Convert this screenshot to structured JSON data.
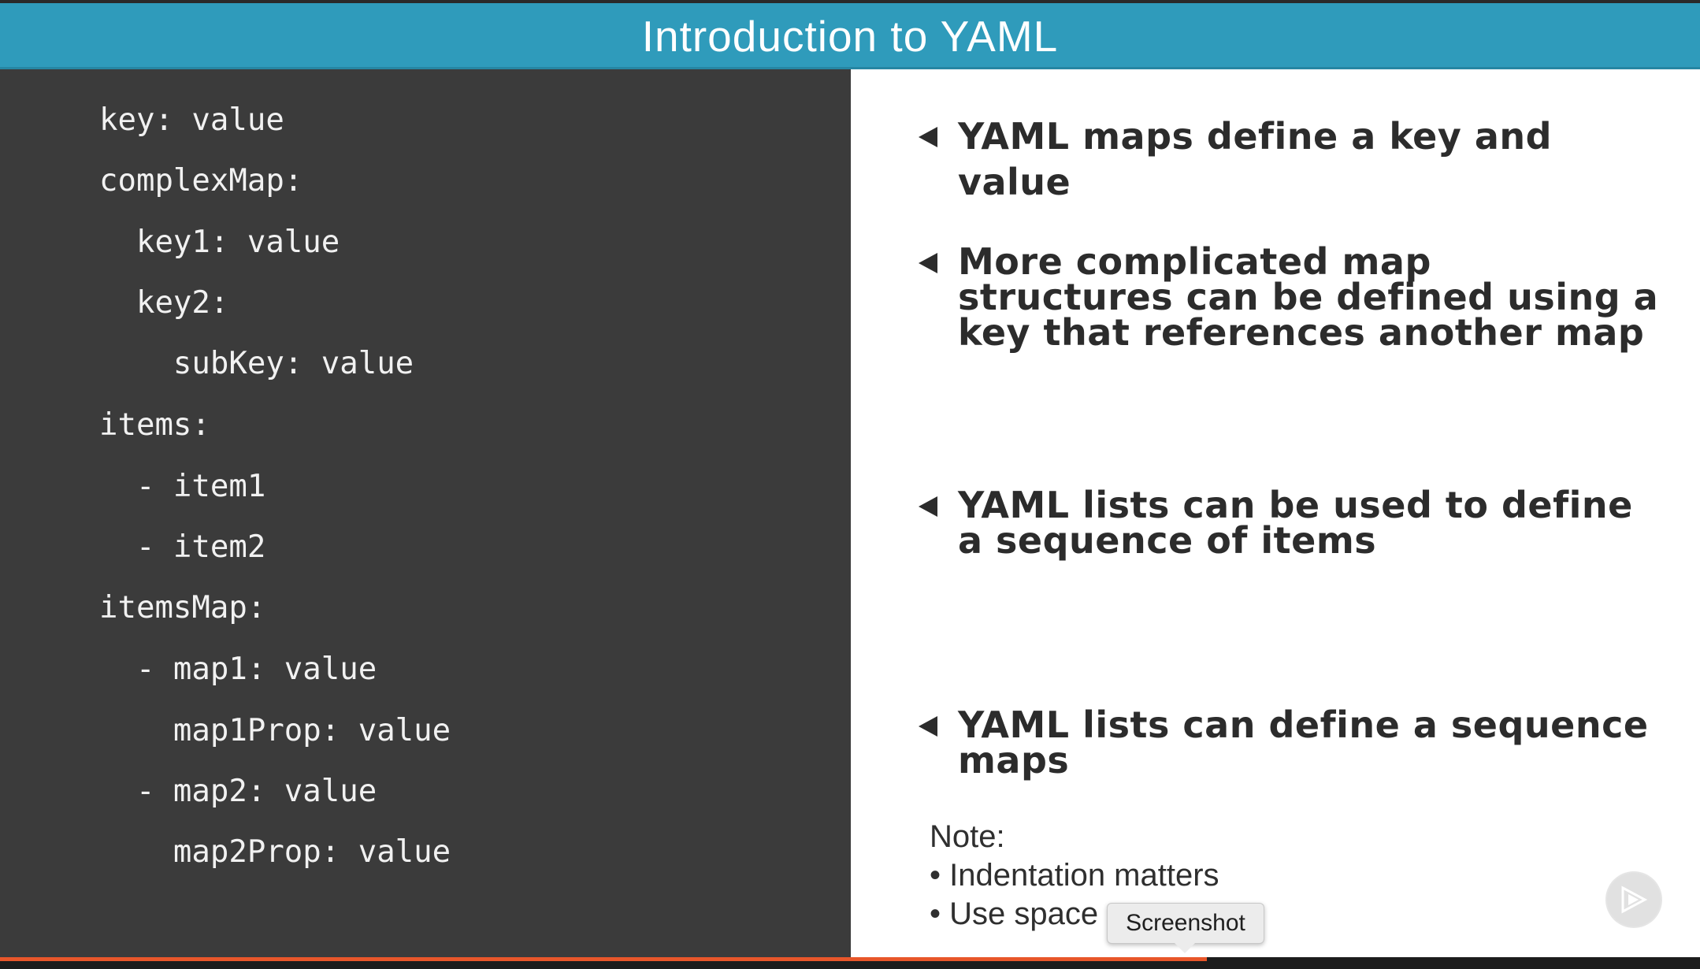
{
  "slide": {
    "title": "Introduction to YAML"
  },
  "code_lines": [
    "key: value",
    "complexMap:",
    "  key1: value",
    "  key2:",
    "    subKey: value",
    "items:",
    "  - item1",
    "  - item2",
    "itemsMap:",
    "  - map1: value",
    "    map1Prop: value",
    "  - map2: value",
    "    map2Prop: value"
  ],
  "bullets": [
    "YAML maps define a key and value",
    "More complicated map structures can be defined using a key that references another map",
    "YAML lists can be used to define a sequence of items",
    "YAML lists can define a sequence maps"
  ],
  "note": {
    "heading": "Note:",
    "items": [
      "• Indentation matters",
      "• Use space"
    ]
  },
  "tooltip": {
    "label": "Screenshot"
  },
  "player": {
    "progress_fraction": 0.71,
    "progress_color": "#e8562a"
  },
  "colors": {
    "title_bar": "#2f9bbb",
    "code_background": "#3b3b3b",
    "notes_background": "#ffffff"
  },
  "icons": {
    "bullet": "triangle-left-icon",
    "player": "play-logo-icon"
  }
}
